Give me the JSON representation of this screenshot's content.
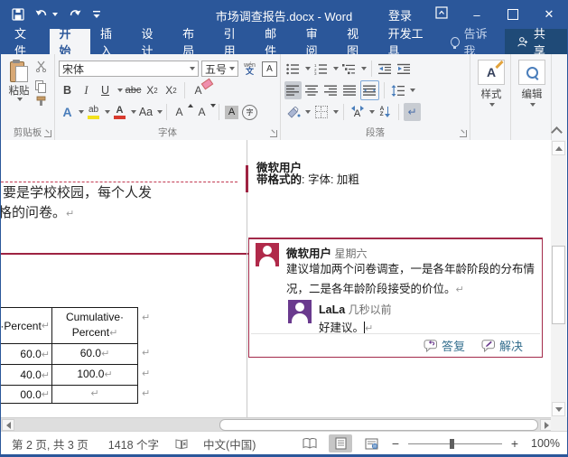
{
  "colors": {
    "accent": "#2b579a",
    "review_red": "#9e2342",
    "avatar_red": "#b02a4a",
    "avatar_purple": "#6a3a8e",
    "link_blue": "#36708f",
    "highlight_yellow": "#f3e11d",
    "font_color_red": "#d83b2f"
  },
  "titlebar": {
    "title": "市场调查报告.docx - Word",
    "sign_in": "登录"
  },
  "tabs": {
    "file": "文件",
    "items": [
      "开始",
      "插入",
      "设计",
      "布局",
      "引用",
      "邮件",
      "审阅",
      "视图",
      "开发工具"
    ],
    "tell_me": "告诉我",
    "share": "共享"
  },
  "ribbon": {
    "paste_label": "粘贴",
    "clipboard_group": "剪贴板",
    "font_group": "字体",
    "paragraph_group": "段落",
    "styles_label": "样式",
    "editing_label": "编辑",
    "font_name": "宋体",
    "font_size": "五号"
  },
  "icons": {
    "bold": "B",
    "italic": "I",
    "underline": "U",
    "strikethrough": "abc",
    "sub_base": "X",
    "sub_small": "2",
    "sup_base": "X",
    "sup_small": "2",
    "clear_format": "A",
    "text_effects": "A",
    "highlight": "ab",
    "font_color": "A",
    "change_case": "Aa",
    "grow_font": "A",
    "shrink_font": "A",
    "char_shading": "A",
    "enclose": "字",
    "char_border": "A",
    "phonetic_top": "wén",
    "phonetic_bottom": "文",
    "asian": "A",
    "sort_a": "A",
    "sort_z": "Z",
    "show_marks": "↵",
    "pilcrow": "↵",
    "close": "✕",
    "minimize": "–"
  },
  "document": {
    "text_line1": "要是学校校园，每个人发",
    "text_line2": "格的问卷。",
    "table": {
      "header_col1": "·Percent",
      "header_col2a": "Cumulative·",
      "header_col2b": "Percent",
      "rows": [
        [
          "60.0",
          "60.0"
        ],
        [
          "40.0",
          "100.0"
        ],
        [
          "00.0",
          ""
        ]
      ]
    }
  },
  "markup": {
    "change_author": "微软用户",
    "change_label": "带格式的",
    "change_detail": ": 字体: 加粗",
    "comment": {
      "author": "微软用户",
      "time": "星期六",
      "body": "建议增加两个问卷调查，一是各年龄阶段的分布情况，二是各年龄阶段接受的价位。",
      "reply_author": "LaLa",
      "reply_time": "几秒以前",
      "reply_body": "好建议。",
      "reply_button": "答复",
      "resolve_button": "解决"
    }
  },
  "statusbar": {
    "page": "第 2 页, 共 3 页",
    "words": "1418 个字",
    "language": "中文(中国)",
    "zoom": "100%"
  }
}
